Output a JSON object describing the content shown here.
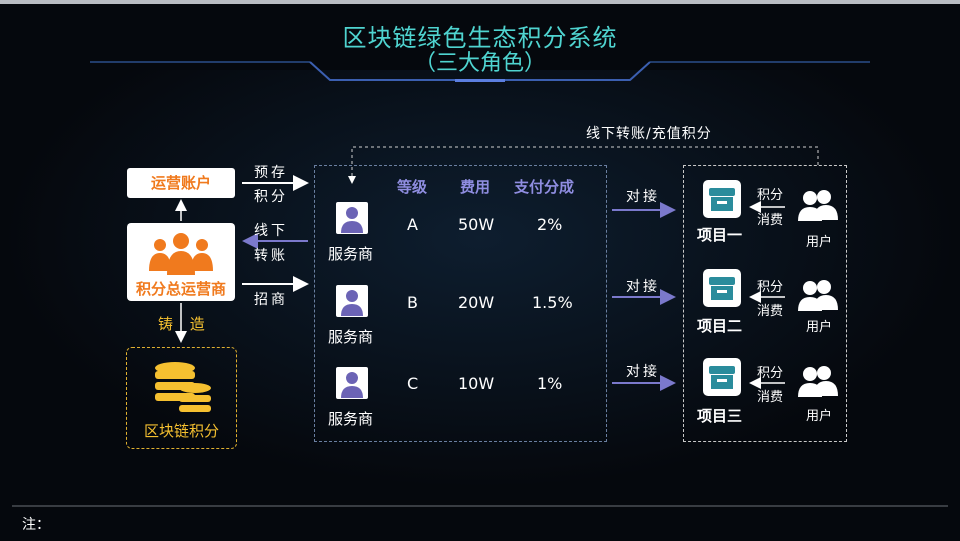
{
  "title": {
    "line1": "区块链绿色生态积分系统",
    "line2": "（三大角色）"
  },
  "left": {
    "op_account": "运营账户",
    "main_operator": "积分总运营商",
    "blockchain_points": "区块链积分",
    "mint_label": "铸 造"
  },
  "arrows": {
    "prestore_1": "预存",
    "prestore_2": "积分",
    "offline_1": "线下",
    "offline_2": "转账",
    "recruit": "招商",
    "top_loop": "线下转账/充值积分",
    "connect": "对接"
  },
  "table": {
    "headers": [
      "等级",
      "费用",
      "支付分成"
    ],
    "rows": [
      {
        "provider": "服务商",
        "level": "A",
        "fee": "50W",
        "share": "2%"
      },
      {
        "provider": "服务商",
        "level": "B",
        "fee": "20W",
        "share": "1.5%"
      },
      {
        "provider": "服务商",
        "level": "C",
        "fee": "10W",
        "share": "1%"
      }
    ]
  },
  "projects": [
    {
      "name": "项目一",
      "points": "积分",
      "consume": "消费",
      "user": "用户"
    },
    {
      "name": "项目二",
      "points": "积分",
      "consume": "消费",
      "user": "用户"
    },
    {
      "name": "项目三",
      "points": "积分",
      "consume": "消费",
      "user": "用户"
    }
  ],
  "note": "注：",
  "colors": {
    "title": "#4fd4d0",
    "orange": "#f07a1e",
    "gold": "#f5c030",
    "header_purple": "#8f8de0",
    "arrow_purple": "#6e6cc0",
    "teal_icon": "#2a8c9c"
  }
}
